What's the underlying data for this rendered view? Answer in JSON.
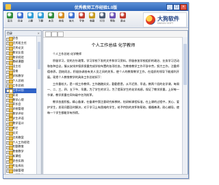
{
  "window": {
    "title": "优秀教师工作经验1.0版"
  },
  "controls": {
    "minimize": "_",
    "maximize": "□",
    "close": "×"
  },
  "toolbar": {
    "buttons": [
      {
        "label": "首页",
        "color": "#2e8b3a"
      },
      {
        "label": "目录",
        "color": "#3b6fd1"
      },
      {
        "label": "上翻",
        "color": "#2b9bd6"
      },
      {
        "label": "下翻",
        "color": "#2b9bd6"
      },
      {
        "label": "末页",
        "color": "#2e8b3a"
      },
      {
        "label": "查找",
        "color": "#d48b1f"
      },
      {
        "label": "放大",
        "color": "#3b6fd1"
      },
      {
        "label": "字体",
        "color": "#c0392b"
      },
      {
        "label": "收藏",
        "color": "#c79a1c"
      },
      {
        "label": "打印",
        "color": "#4a5a72"
      },
      {
        "label": "帮助",
        "color": "#6a4fb3"
      },
      {
        "label": "退出",
        "color": "#c0392b"
      }
    ]
  },
  "logo": {
    "text": "大狗软件",
    "sub": "DAGOU SOFT"
  },
  "sidebar": {
    "header": "目录",
    "close": "×",
    "items": [
      {
        "label": "综合",
        "selected": false
      },
      {
        "label": "优秀班主任",
        "selected": false
      },
      {
        "label": "优秀论文",
        "selected": false
      },
      {
        "label": "教学反思",
        "selected": false
      },
      {
        "label": "教学经验",
        "selected": false
      },
      {
        "label": "教研课题",
        "selected": false
      },
      {
        "label": "班主任",
        "selected": false
      },
      {
        "label": "德育",
        "selected": false
      },
      {
        "label": "学科教学",
        "selected": false
      },
      {
        "label": "个人总结",
        "selected": false
      },
      {
        "label": "工作总结",
        "selected": false
      },
      {
        "label": "工作计划",
        "selected": true
      },
      {
        "label": "家访",
        "selected": false
      },
      {
        "label": "教学心得",
        "selected": false
      },
      {
        "label": "家长会",
        "selected": false
      },
      {
        "label": "学校管理",
        "selected": false
      },
      {
        "label": "教学评价",
        "selected": false
      },
      {
        "label": "学生评语",
        "selected": false
      },
      {
        "label": "教学设计",
        "selected": false
      },
      {
        "label": "其它",
        "selected": false
      },
      {
        "label": "论文",
        "selected": false
      },
      {
        "label": "优秀教案",
        "selected": false
      },
      {
        "label": "个人工作经验",
        "selected": false
      },
      {
        "label": "专题教育",
        "selected": false
      },
      {
        "label": "教育教学",
        "selected": false
      },
      {
        "label": "新课程",
        "selected": false
      },
      {
        "label": "综合实践",
        "selected": false
      },
      {
        "label": "专业成长",
        "selected": false
      },
      {
        "label": "班级管理",
        "selected": false
      },
      {
        "label": "小班教学",
        "selected": false
      }
    ]
  },
  "document": {
    "title": "个人工作总结 化学教师",
    "paragraphs": [
      "个人工作总结 化学教师",
      "积极学习，党的方针政策，学习学校下发的文件和学习资料，积极参加学校组织的政治、业务学习活动和各种会议，服从安排并保质保量完成学校布置的各项任务。为教育教学工作不辞辛劳，努力工作，注重师德修养，团结同志，积极协调各有关人员之间的关系，使个人的教育教学工作，在组织的领导下能顺利开展。现把个人教育教学的具体工作总结如下：",
      "工作量较大，是一线工作教师，工作踏踏实实，勤勤恳恳，从不迟到、早退，教两个班的化学课，每周一、二、三、四、五下午、早晨，为了学生的学习，为了提高学生的化学成绩，保证了教学质量，上好每一节课，教学质量在同年级中名列前茅。",
      "教学态度积极，精心备课，在备课中我注意研究新教材，钻研新课程标准，在上课的过程中，关心、爱护学生，发现问题及时解决，对于学习上有困难的学生，给予特别的关怀和帮助，循循善诱，耐心辅导，使每一个学生都能学有所得。"
    ]
  }
}
